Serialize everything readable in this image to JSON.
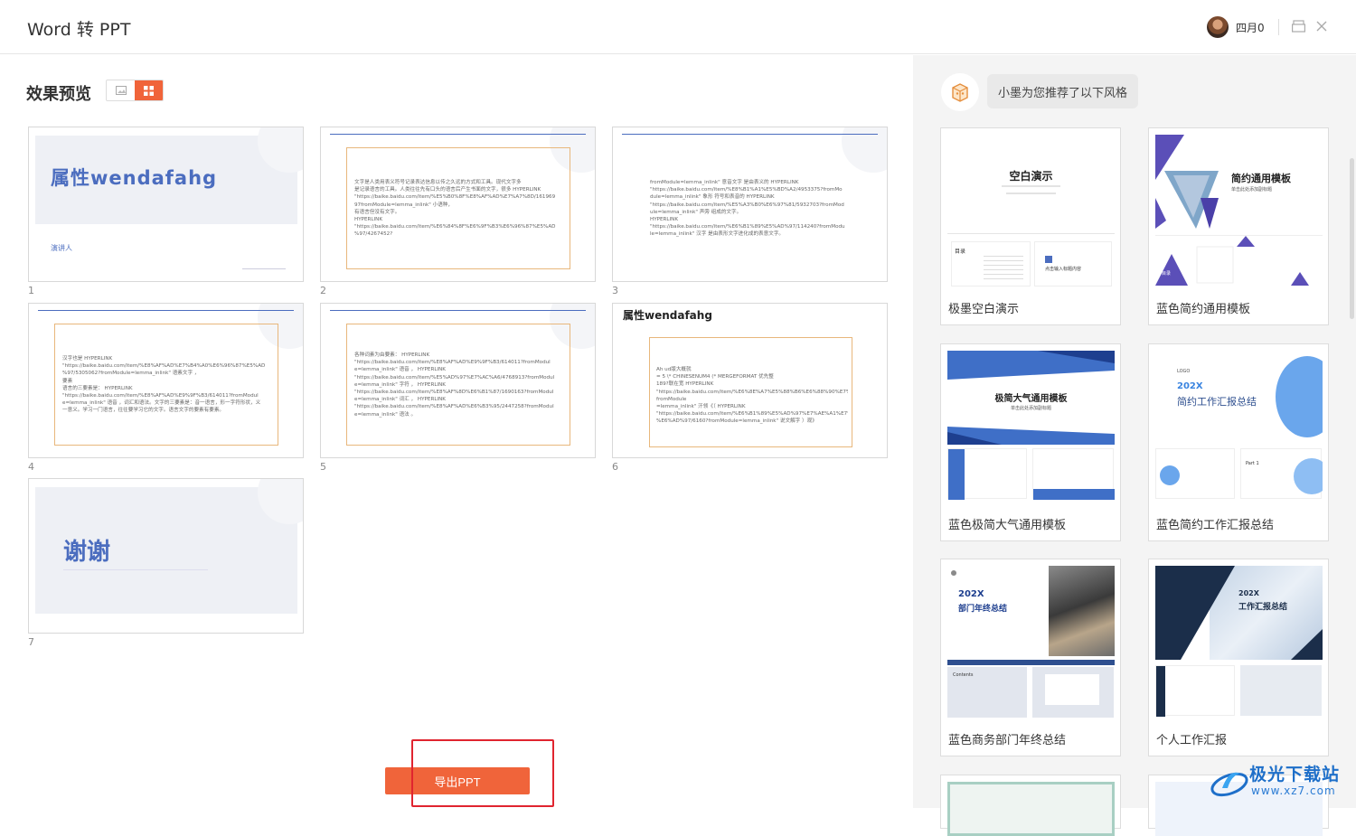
{
  "app": {
    "title": "Word 转 PPT",
    "user": {
      "name": "四月0"
    }
  },
  "preview": {
    "title": "效果预览",
    "view_modes": [
      "single-view",
      "grid-view"
    ],
    "active_view": "grid-view",
    "slides": [
      {
        "num": "1",
        "title": "属性wendafahg",
        "subtitle": "演讲人"
      },
      {
        "num": "2",
        "text": "文字是人类用表义符号记录表达信息以传之久远的方式和工具。现代文字多\n是记录语言的工具。人类往往先有口头的语言后产生书面的文字，很多 HYPERLINK\n\"https://baike.baidu.com/item/%E5%B0%8F%E8%AF%AD%E7%A7%8D/161969\n97fromModule=lemma_inlink\" 小语种，\n有语言但没有文字。\nHYPERLINK\n\"https://baike.baidu.com/item/%E6%84%8F%E6%9F%B3%E6%96%87%E5%AD\n%97/4267452?"
      },
      {
        "num": "3",
        "text": "fromModule=lemma_inlink\" 意音文字 是由表义的 HYPERLINK\n\"https://baike.baidu.com/item/%E8%B1%A1%E5%BD%A2/4953375?fromMo\ndule=lemma_inlink\" 象形 符号和表音的 HYPERLINK\n\"https://baike.baidu.com/item/%E5%A3%B0%E6%97%81/5932703?fromMod\nule=lemma_inlink\" 声旁 组成的文字。\nHYPERLINK\n\"https://baike.baidu.com/item/%E6%B1%89%E5%AD%97/114240?fromModu\nle=lemma_inlink\" 汉字 是由表形文字进化成的表意文字。"
      },
      {
        "num": "4",
        "text": "汉字也是 HYPERLINK\n\"https://baike.baidu.com/item/%E8%AF%AD%E7%B4%A0%E6%96%87%E5%AD\n%97/5305062?fromModule=lemma_inlink\" 语素文字 ，\n要素\n语言的三要素是： HYPERLINK\n\"https://baike.baidu.com/item/%E8%AF%AD%E9%9F%B3/614011?fromModul\ne=lemma_inlink\" 语音 ，词汇和语法。文字的三要素是：音一语言，形一字符形状，义\n一意义。学习一门语言，往往要学习它的文字。语言文字的要素有要素。"
      },
      {
        "num": "5",
        "text": "各种词素为由要素： HYPERLINK\n\"https://baike.baidu.com/item/%E8%AF%AD%E9%9F%B3/614011?fromModul\ne=lemma_inlink\" 语音 ， HYPERLINK\n\"https://baike.baidu.com/item/%E5%AD%97%E7%AC%A6/4768913?fromModul\ne=lemma_inlink\" 字符 ， HYPERLINK\n\"https://baike.baidu.com/item/%E8%AF%8D%E6%B1%87/1690163?fromModul\ne=lemma_inlink\" 词汇 ， HYPERLINK\n\"https://baike.baidu.com/item/%E8%AF%AD%E6%B3%95/2447258?fromModul\ne=lemma_inlink\" 语法 。"
      },
      {
        "num": "6",
        "title": "属性wendafahg",
        "text": "Ah ud版大概就\n= 5 \\* CHINESENUM4 (* MERGEFORMAT 优先整\n189?联在宽 HYPERLINK\n\"https://baike.baidu.com/item/%E6%8E%A7%E5%88%B6%E6%88%90%E7%BB%8F?fromModule\n=lemma_inlink\" 汗领《（ HYPERLINK\n\"https://baike.baidu.com/item/%E6%B1%89%E5%AD%97%E7%AE%A1%E7%A3\n%E6%AD%97/6160?fromModule=lemma_inlink\" 说文解字 ）观》"
      },
      {
        "num": "7",
        "title": "谢谢"
      }
    ],
    "export_label": "导出PPT"
  },
  "recommend": {
    "message": "小墨为您推荐了以下风格",
    "templates": [
      {
        "name": "极墨空白演示",
        "thumb_title": "空白演示",
        "thumb_part": "目录",
        "thumb_section": "点击输入标题内容"
      },
      {
        "name": "蓝色简约通用模板",
        "thumb_title": "简约通用模板",
        "thumb_sub": "单击此处添加副标题",
        "thumb_part": "目录"
      },
      {
        "name": "蓝色极简大气通用模板",
        "thumb_title": "极简大气通用模板",
        "thumb_sub": "单击此处添加副标题"
      },
      {
        "name": "蓝色简约工作汇报总结",
        "thumb_year": "202X",
        "thumb_title": "简约工作汇报总结",
        "thumb_logo": "LOGO",
        "thumb_part": "Part 1"
      },
      {
        "name": "蓝色商务部门年终总结",
        "thumb_year": "202X",
        "thumb_title": "部门年终总结",
        "thumb_part": "Contents"
      },
      {
        "name": "个人工作汇报",
        "thumb_year": "202X",
        "thumb_title": "工作汇报总结"
      }
    ]
  },
  "watermark": {
    "text": "极光下载站",
    "url": "www.xz7.com"
  },
  "colors": {
    "accent": "#f0643a",
    "slide_blue": "#4b6dbf",
    "highlight": "#e0242f"
  }
}
